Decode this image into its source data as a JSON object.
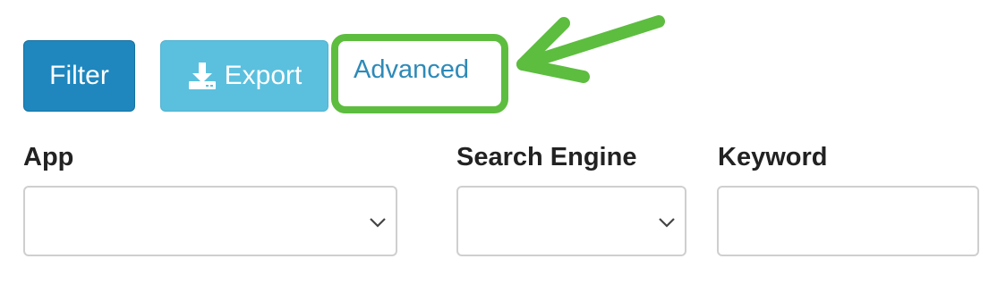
{
  "toolbar": {
    "filter_label": "Filter",
    "export_label": "Export",
    "advanced_label": "Advanced"
  },
  "fields": {
    "app": {
      "label": "App",
      "value": ""
    },
    "search_engine": {
      "label": "Search Engine",
      "value": ""
    },
    "keyword": {
      "label": "Keyword",
      "value": ""
    }
  },
  "colors": {
    "primary": "#1f87bd",
    "info": "#5bc0de",
    "link": "#2d8ab8",
    "annotation": "#5dbd3f"
  },
  "icons": {
    "export": "download-icon",
    "select": "chevron-down-icon"
  }
}
